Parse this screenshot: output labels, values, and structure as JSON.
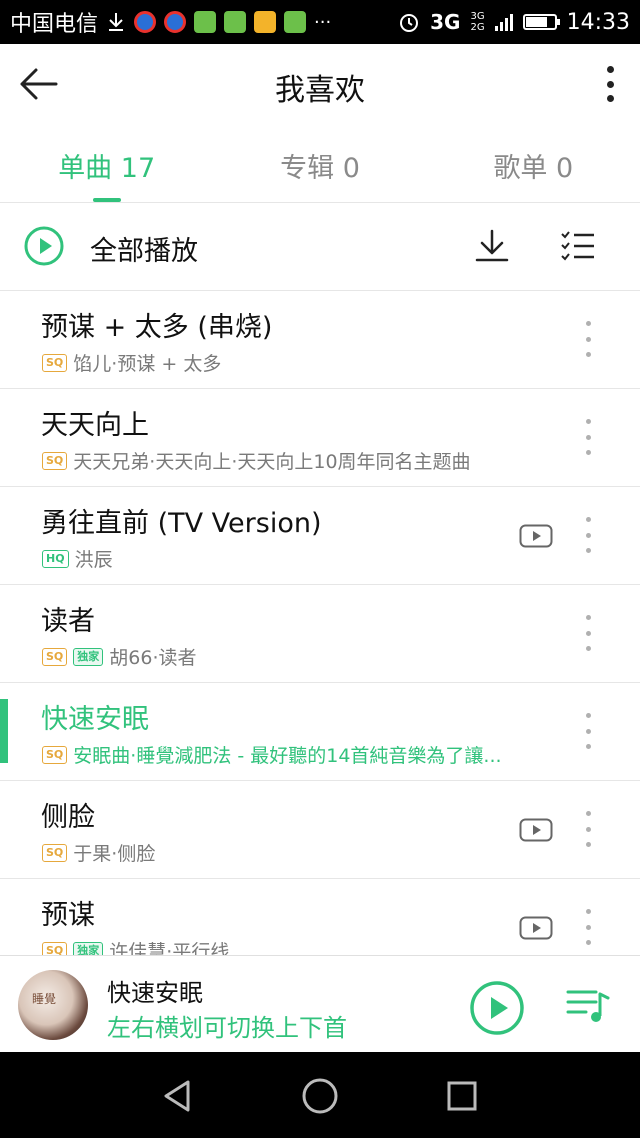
{
  "status_bar": {
    "carrier": "中国电信",
    "overflow": "···",
    "network": "3G",
    "network_small_top": "3G",
    "network_small_bottom": "2G",
    "battery_level": 0.75,
    "time": "14:33",
    "notification_icons": [
      "download-icon",
      "app-icon",
      "app-icon",
      "sogou-icon",
      "sogou-icon",
      "app-icon",
      "sogou-icon"
    ]
  },
  "app_bar": {
    "title": "我喜欢",
    "icons": [
      "back-arrow-icon",
      "more-vertical-icon"
    ]
  },
  "tabs": [
    {
      "label": "单曲 17",
      "active": true
    },
    {
      "label": "专辑 0",
      "active": false
    },
    {
      "label": "歌单 0",
      "active": false
    }
  ],
  "play_all": {
    "label": "全部播放",
    "icons": [
      "play-circle-icon",
      "download-icon",
      "multi-select-icon"
    ]
  },
  "songs": [
    {
      "title": "预谋 + 太多 (串烧)",
      "quality": "SQ",
      "exclusive": "",
      "artist": "馅儿·预谋 + 太多",
      "mv": false,
      "playing": false
    },
    {
      "title": "天天向上",
      "quality": "SQ",
      "exclusive": "",
      "artist": "天天兄弟·天天向上·天天向上10周年同名主题曲",
      "mv": false,
      "playing": false
    },
    {
      "title": "勇往直前 (TV Version)",
      "quality": "HQ",
      "exclusive": "",
      "artist": "洪辰",
      "mv": true,
      "playing": false
    },
    {
      "title": "读者",
      "quality": "SQ",
      "exclusive": "独家",
      "artist": "胡66·读者",
      "mv": false,
      "playing": false
    },
    {
      "title": "快速安眠",
      "quality": "SQ",
      "exclusive": "",
      "artist": "安眠曲·睡覺減肥法 - 最好聽的14首純音樂為了讓...",
      "mv": false,
      "playing": true
    },
    {
      "title": "侧脸",
      "quality": "SQ",
      "exclusive": "",
      "artist": "于果·侧脸",
      "mv": true,
      "playing": false
    },
    {
      "title": "预谋",
      "quality": "SQ",
      "exclusive": "独家",
      "artist": "许佳慧·平行线",
      "mv": true,
      "playing": false
    }
  ],
  "player": {
    "cover_text": "睡覺",
    "title": "快速安眠",
    "hint": "左右横划可切换上下首",
    "icons": [
      "play-circle-icon",
      "playlist-icon"
    ]
  },
  "nav_bar": {
    "icons": [
      "back-triangle-icon",
      "home-circle-icon",
      "recents-square-icon"
    ]
  },
  "colors": {
    "accent": "#31c27c",
    "sq_badge": "#e6a83c",
    "status_bar": "#000000"
  }
}
